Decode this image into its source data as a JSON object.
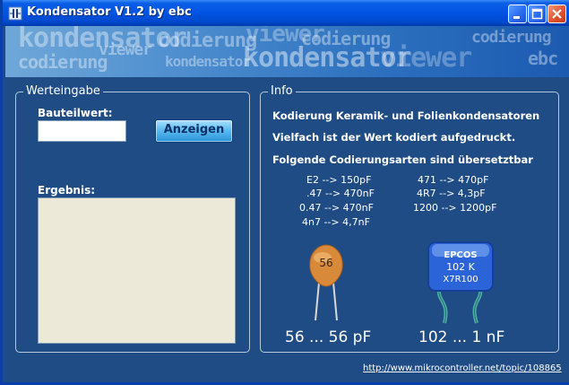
{
  "window": {
    "title": "Kondensator V1.2 by ebc"
  },
  "banner": {
    "words": [
      "kondensator",
      "codierung",
      "viewer",
      "codierung",
      "kondensator",
      "ebc",
      "codierung",
      "viewer",
      "kondensator",
      "codierung"
    ]
  },
  "input_group": {
    "legend": "Werteingabe",
    "bauteilwert_label": "Bauteilwert:",
    "bauteilwert_value": "",
    "show_button": "Anzeigen",
    "result_label": "Ergebnis:",
    "result_value": ""
  },
  "info_group": {
    "legend": "Info",
    "line1": "Kodierung  Keramik- und Folienkondensatoren",
    "line2": "Vielfach ist der Wert kodiert aufgedruckt.",
    "line3": "Folgende Codierungsarten sind übersetztbar",
    "examples_left": [
      "E2 --> 150pF",
      ".47 --> 470nF",
      "0.47 --> 470nF",
      "4n7 --> 4,7nF"
    ],
    "examples_right": [
      "471 --> 470pF",
      "4R7 --> 4,3pF",
      "1200 --> 1200pF"
    ],
    "ceramic_code": "56",
    "ceramic_caption": "56 ... 56 pF",
    "film_brand": "EPCOS",
    "film_code": "102  K",
    "film_type": "X7R100",
    "film_caption": "102 ... 1 nF"
  },
  "footer": {
    "link": "http://www.mikrocontroller.net/topic/108865"
  }
}
